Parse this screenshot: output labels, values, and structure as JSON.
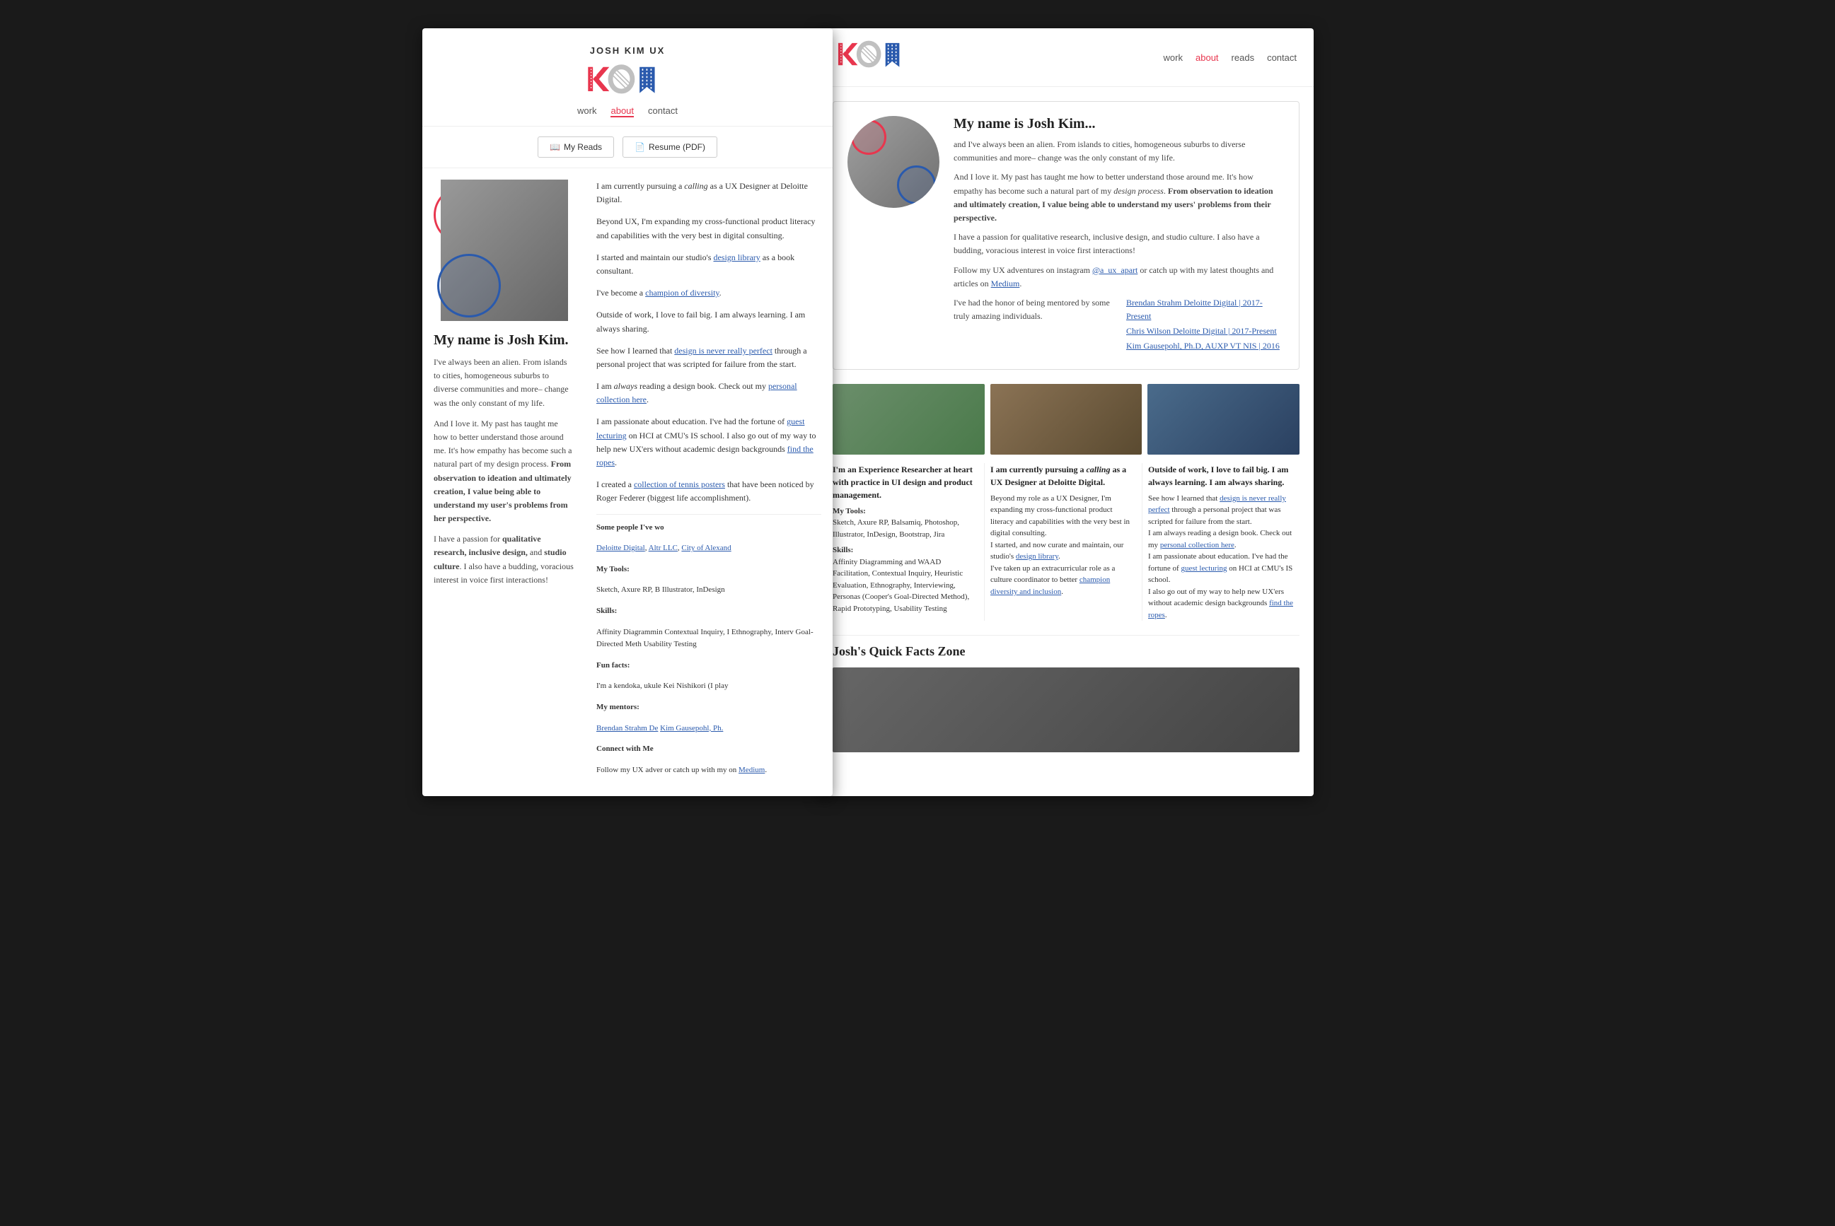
{
  "left_page": {
    "site_title": "JOSH KIM UX",
    "nav": {
      "work": "work",
      "about": "about",
      "contact": "contact",
      "active": "about"
    },
    "buttons": {
      "my_reads": "My Reads",
      "resume": "Resume (PDF)"
    },
    "bio": {
      "heading": "My name is Josh Kim.",
      "para1": "I've always been an alien. From islands to cities, homogeneous suburbs to diverse communities and more– change was the only constant of my life.",
      "para2": "And I love it. My past has taught me how to better understand those around me. It's how empathy has become such a natural part of my design process. From observation to ideation and ultimately creation, I value being able to understand my user's problems from her perspective.",
      "para3": "I have a passion for qualitative research, inclusive design, and studio culture. I also have a budding, voracious interest in voice first interactions!"
    },
    "main_text": {
      "para1": "I am currently pursuing a calling as a UX Designer at Deloitte Digital.",
      "para2": "Beyond UX, I'm expanding my cross-functional product literacy and capabilities with the very best in digital consulting.",
      "para3": "I started and maintain our studio's design library as a book consultant.",
      "para4": "I've become a champion of diversity.",
      "para5": "Outside of work, I love to fail big. I am always learning. I am always sharing.",
      "para6": "See how I learned that design is never really perfect through a personal project that was scripted for failure from the start.",
      "para7": "I am always reading a design book. Check out my personal collection here.",
      "para8": "I am passionate about education. I've had the fortune of guest lecturing on HCI at CMU's IS school. I also go out of my way to help new UX'ers without academic design backgrounds find the ropes.",
      "para9": "I created a collection of tennis posters that have been noticed by Roger Federer (biggest life accomplishment).",
      "people_heading": "Some people I've wo",
      "people_links": "Deloitte Digital, Altr LLC, City of Alexand",
      "tools_heading": "My Tools:",
      "tools_text": "Sketch, Axure RP, B Illustrator, InDesign",
      "skills_heading": "Skills:",
      "skills_text": "Affinity Diagrammin Contextual Inquiry, I Ethnography, Interv Goal-Directed Meth Usability Testing",
      "fun_facts_heading": "Fun facts:",
      "fun_facts_text": "I'm a kendoka, ukule Kei Nishikori (I play",
      "mentors_heading": "My mentors:",
      "mentors_text": "Brendan Strahm De Kim Gausepohl, Ph.",
      "connect_heading": "Connect with Me",
      "connect_text": "Follow my UX adver or catch up with my on Medium."
    }
  },
  "right_page": {
    "nav": {
      "work": "work",
      "about": "about",
      "reads": "reads",
      "contact": "contact",
      "active": "about"
    },
    "about_card": {
      "heading": "My name is Josh Kim...",
      "para1": "and I've always been an alien. From islands to cities, homogeneous suburbs to diverse communities and more– change was the only constant of my life.",
      "para2": "And I love it. My past has taught me how to better understand those around me. It's how empathy has become such a natural part of my design process. From observation to ideation and ultimately creation, I value being able to understand my users' problems from their perspective.",
      "para3": "I have a passion for qualitative research, inclusive design, and studio culture. I also have a budding, voracious interest in voice first interactions!",
      "para4_prefix": "Follow my UX adventures on instagram ",
      "instagram": "@a_ux_apart",
      "para4_mid": " or catch up with my latest thoughts and articles on ",
      "medium": "Medium",
      "para5_prefix": "I've had the honor of being mentored by some truly amazing individuals.",
      "mentor1": "Brendan Strahm Deloitte Digital | 2017-Present",
      "mentor2": "Chris Wilson Deloitte Digital | 2017-Present",
      "mentor3": "Kim Gausepohl, Ph.D, AUXP VT NIS | 2016"
    },
    "col1": {
      "heading": "I'm an Experience Researcher at heart with practice in UI design and product management.",
      "tools_heading": "My Tools:",
      "tools": "Sketch, Axure RP, Balsamiq, Photoshop, Illustrator, InDesign, Bootstrap, Jira",
      "skills_heading": "Skills:",
      "skills": "Affinity Diagramming and WAAD Facilitation, Contextual Inquiry, Heuristic Evaluation, Ethnography, Interviewing, Personas (Cooper's Goal-Directed Method), Rapid Prototyping, Usability Testing"
    },
    "col2": {
      "heading": "I am currently pursuing a calling as a UX Designer at Deloitte Digital.",
      "para1": "Beyond my role as a UX Designer, I'm expanding my cross-functional product literacy and capabilities with the very best in digital consulting.",
      "para2": "I started, and now curate and maintain, our studio's design library.",
      "para3": "I've taken up an extracurricular role as a culture coordinator to better champion diversity and inclusion."
    },
    "col3": {
      "heading": "Outside of work, I love to fail big. I am always learning. I am always sharing.",
      "para1_prefix": "See how I learned that ",
      "link1": "design is never really perfect",
      "para1_mid": " through a personal project that was scripted for failure from the start.",
      "para2_prefix": "I am always reading a design book. Check out my ",
      "link2": "personal collection here",
      "para3_prefix": "I am passionate about education. I've had the fortune of ",
      "link3": "guest lecturing",
      "para3_mid": " on HCI at CMU's IS school.",
      "para4_prefix": "I also go out of my way to help new UX'ers without academic design backgrounds ",
      "link4": "find the ropes",
      "para4_end": "."
    },
    "quick_facts": {
      "heading": "Josh's Quick Facts Zone"
    }
  }
}
